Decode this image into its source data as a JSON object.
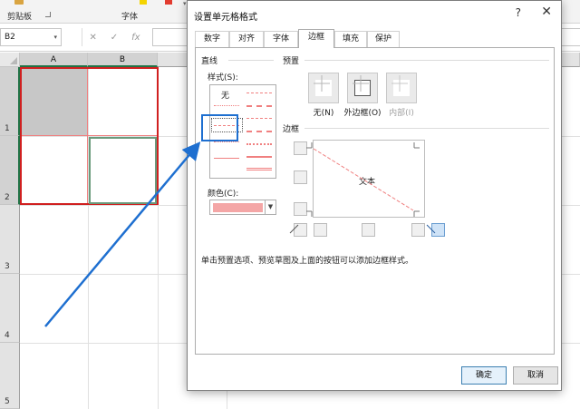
{
  "ribbon": {
    "clipboard_label": "剪贴板",
    "font_label": "字体"
  },
  "formula_bar": {
    "name_box": "B2",
    "cancel_icon": "✕",
    "enter_icon": "✓",
    "fx_label": "fx",
    "value": ""
  },
  "sheet": {
    "columns": [
      "A",
      "B"
    ],
    "rows": [
      "1",
      "2",
      "3",
      "4",
      "5"
    ],
    "border_color": "#d02020",
    "preview_color": "#f08080"
  },
  "dialog": {
    "title": "设置单元格格式",
    "help": "?",
    "close": "✕",
    "tabs": [
      {
        "label": "数字",
        "active": false
      },
      {
        "label": "对齐",
        "active": false
      },
      {
        "label": "字体",
        "active": false
      },
      {
        "label": "边框",
        "active": true
      },
      {
        "label": "填充",
        "active": false
      },
      {
        "label": "保护",
        "active": false
      }
    ],
    "line_section": "直线",
    "style_label": "样式(S):",
    "style_none": "无",
    "color_label": "颜色(C):",
    "selected_color": "#f4a6a6",
    "presets_section": "预置",
    "presets": [
      {
        "label": "无(N)",
        "enabled": true
      },
      {
        "label": "外边框(O)",
        "enabled": true
      },
      {
        "label": "内部(I)",
        "enabled": false
      }
    ],
    "border_section": "边框",
    "preview_text": "文本",
    "hint": "单击预置选项、预览草图及上面的按钮可以添加边框样式。",
    "ok_label": "确定",
    "cancel_label": "取消"
  },
  "annotation": {
    "color": "#1e6fd0"
  }
}
